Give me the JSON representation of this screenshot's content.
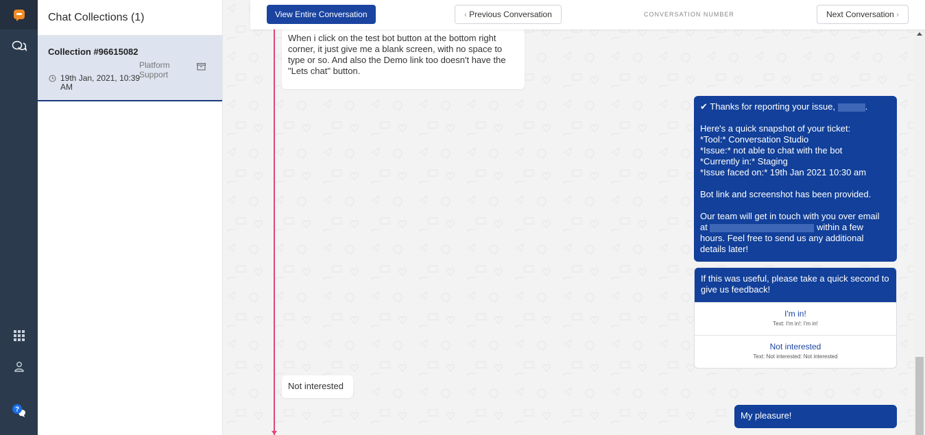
{
  "panel": {
    "title": "Chat Collections (1)",
    "collection": {
      "title": "Collection #96615082",
      "time": "19th Jan, 2021, 10:39 AM",
      "tag": "Platform Support"
    }
  },
  "rail": {
    "icons": [
      "app-logo-icon",
      "chat-bubbles-icon",
      "apps-grid-icon",
      "user-icon",
      "help-icon"
    ]
  },
  "toolbar": {
    "view_entire_label": "View Entire Conversation",
    "prev_label": "Previous Conversation",
    "conversation_number_label": "CONVERSATION NUMBER",
    "next_label": "Next Conversation"
  },
  "messages": {
    "user_first": "When i click on the test bot button at the bottom right corner, it just give me a blank screen, with no space to type or so. And also the Demo link too doesn't have the \"Lets chat\" button.",
    "bot_snapshot": {
      "line1_prefix": "✔ Thanks for reporting your issue,",
      "line1_suffix": ".",
      "line2": "Here's a quick snapshot of your ticket:",
      "line3": "*Tool:* Conversation Studio",
      "line4": "*Issue:* not able to chat with the bot",
      "line5": "*Currently in:* Staging",
      "line6": "*Issue faced on:*  19th Jan 2021 10:30 am",
      "line7": "Bot link and screenshot has been provided.",
      "line8": "Our team will get in touch with you over email",
      "line9_prefix": "at",
      "line9_suffix": "within a few",
      "line10": "hours. Feel free to send us any additional",
      "line11": "details later!"
    },
    "feedback": {
      "prompt": "If this was useful, please take a quick second to give us feedback!",
      "options": [
        {
          "title": "I'm in!",
          "sub": "Text: I'm in!: I'm in!"
        },
        {
          "title": "Not interested",
          "sub": "Text: Not interested: Not interested"
        }
      ]
    },
    "user_second": "Not interested",
    "bot_final": "My pleasure!"
  },
  "colors": {
    "rail": "#2b3a4d",
    "accent": "#1a44a0",
    "bot_bubble": "#12409a",
    "timeline": "#e0457b",
    "selected_item": "#dde4ef",
    "logo": "#f08a24"
  }
}
